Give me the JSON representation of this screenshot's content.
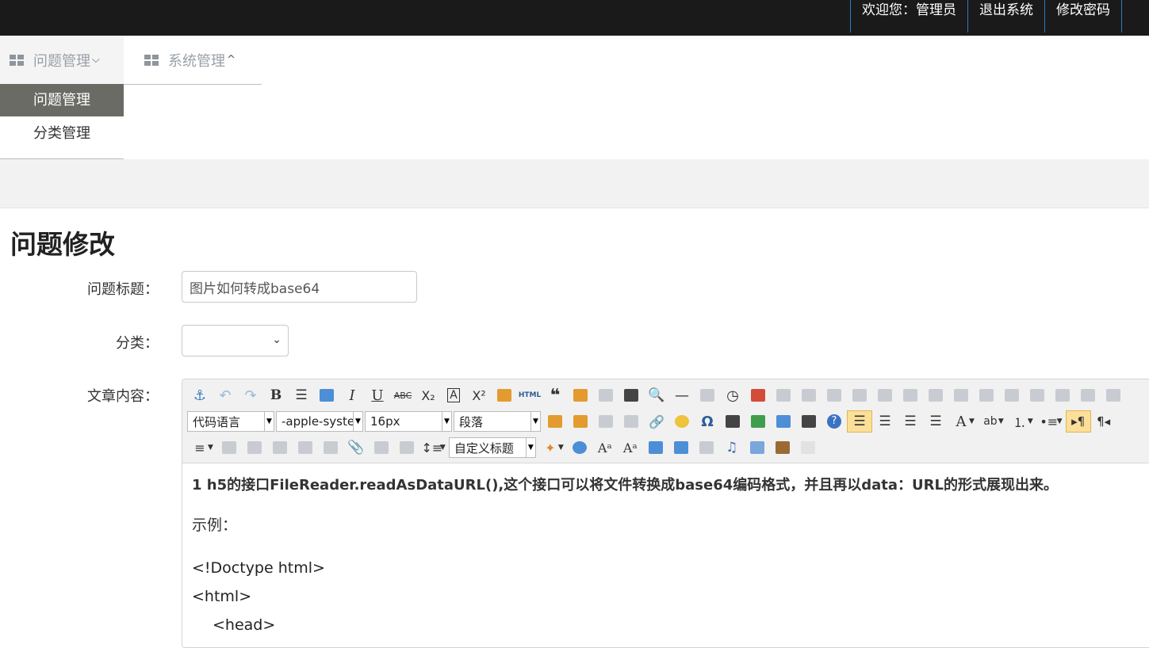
{
  "topnav": {
    "welcome": "欢迎您：管理员",
    "logout": "退出系统",
    "change_password": "修改密码"
  },
  "menu": {
    "items": [
      {
        "label": "问题管理",
        "caret": "⌄",
        "icon": "grid-icon"
      },
      {
        "label": "系统管理",
        "caret": "⌃",
        "icon": "grid-icon"
      }
    ],
    "submenu": [
      {
        "label": "问题管理",
        "active": true
      },
      {
        "label": "分类管理",
        "active": false
      }
    ]
  },
  "page": {
    "title": "问题修改"
  },
  "form": {
    "title_label": "问题标题：",
    "title_value": "图片如何转成base64",
    "category_label": "分类：",
    "category_value": "",
    "content_label": "文章内容："
  },
  "editor": {
    "combos": {
      "code_language": "代码语言",
      "font_family": "-apple-syste",
      "font_size": "16px",
      "paragraph": "段落",
      "custom_title": "自定义标题"
    },
    "content": {
      "line1": "1 h5的接口FileReader.readAsDataURL(),这个接口可以将文件转换成base64编码格式，并且再以data：URL的形式展现出来。",
      "line2": "示例：",
      "code": [
        "<!Doctype html>",
        "<html>",
        "<head>"
      ]
    }
  },
  "colors": {
    "topbar": "#1a1a1a",
    "topnav_border": "#2e7bbf",
    "submenu_active": "#6b6b66"
  }
}
